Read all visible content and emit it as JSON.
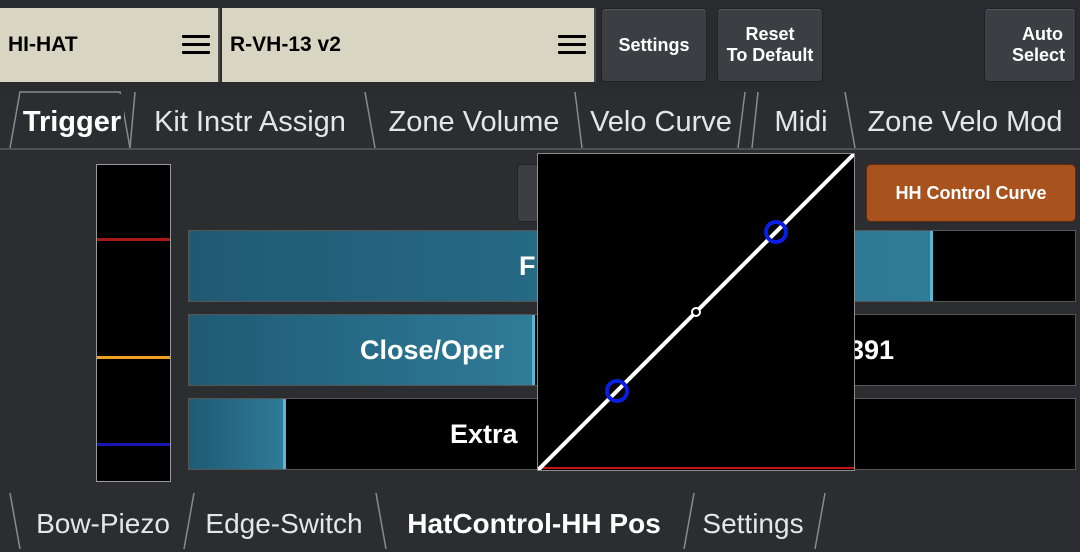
{
  "header": {
    "instrument": "HI-HAT",
    "kit": "R-VH-13 v2",
    "settings_label": "Settings",
    "reset_label_1": "Reset",
    "reset_label_2": "To Default",
    "auto_label_1": "Auto",
    "auto_label_2": "Select"
  },
  "tabs": [
    {
      "label": "Trigger",
      "active": true
    },
    {
      "label": "Kit Instr Assign",
      "active": false
    },
    {
      "label": "Zone Volume",
      "active": false
    },
    {
      "label": "Velo Curve",
      "active": false
    },
    {
      "label": "Midi",
      "active": false
    },
    {
      "label": "Zone Velo Mod",
      "active": false
    }
  ],
  "controls": {
    "hh_control_curve_label": "HH Control Curve",
    "bar1_label": "F",
    "bar1_value": 0.84,
    "bar2_label": "Close/Oper",
    "bar2_value_text": "391",
    "bar2_value": 0.39,
    "bar3_label": "Extra",
    "bar3_value": 0.11
  },
  "meter": {
    "colors": [
      "#a81818",
      "#f0a020",
      "#1818b0"
    ]
  },
  "curve": {
    "line_color": "#ffffff",
    "handle_color": "#0a1ee0",
    "baseline_color": "#c81414"
  },
  "bottom_tabs": [
    {
      "label": "Bow-Piezo",
      "active": false
    },
    {
      "label": "Edge-Switch",
      "active": false
    },
    {
      "label": "HatControl-HH Pos",
      "active": true
    },
    {
      "label": "Settings",
      "active": false
    }
  ]
}
